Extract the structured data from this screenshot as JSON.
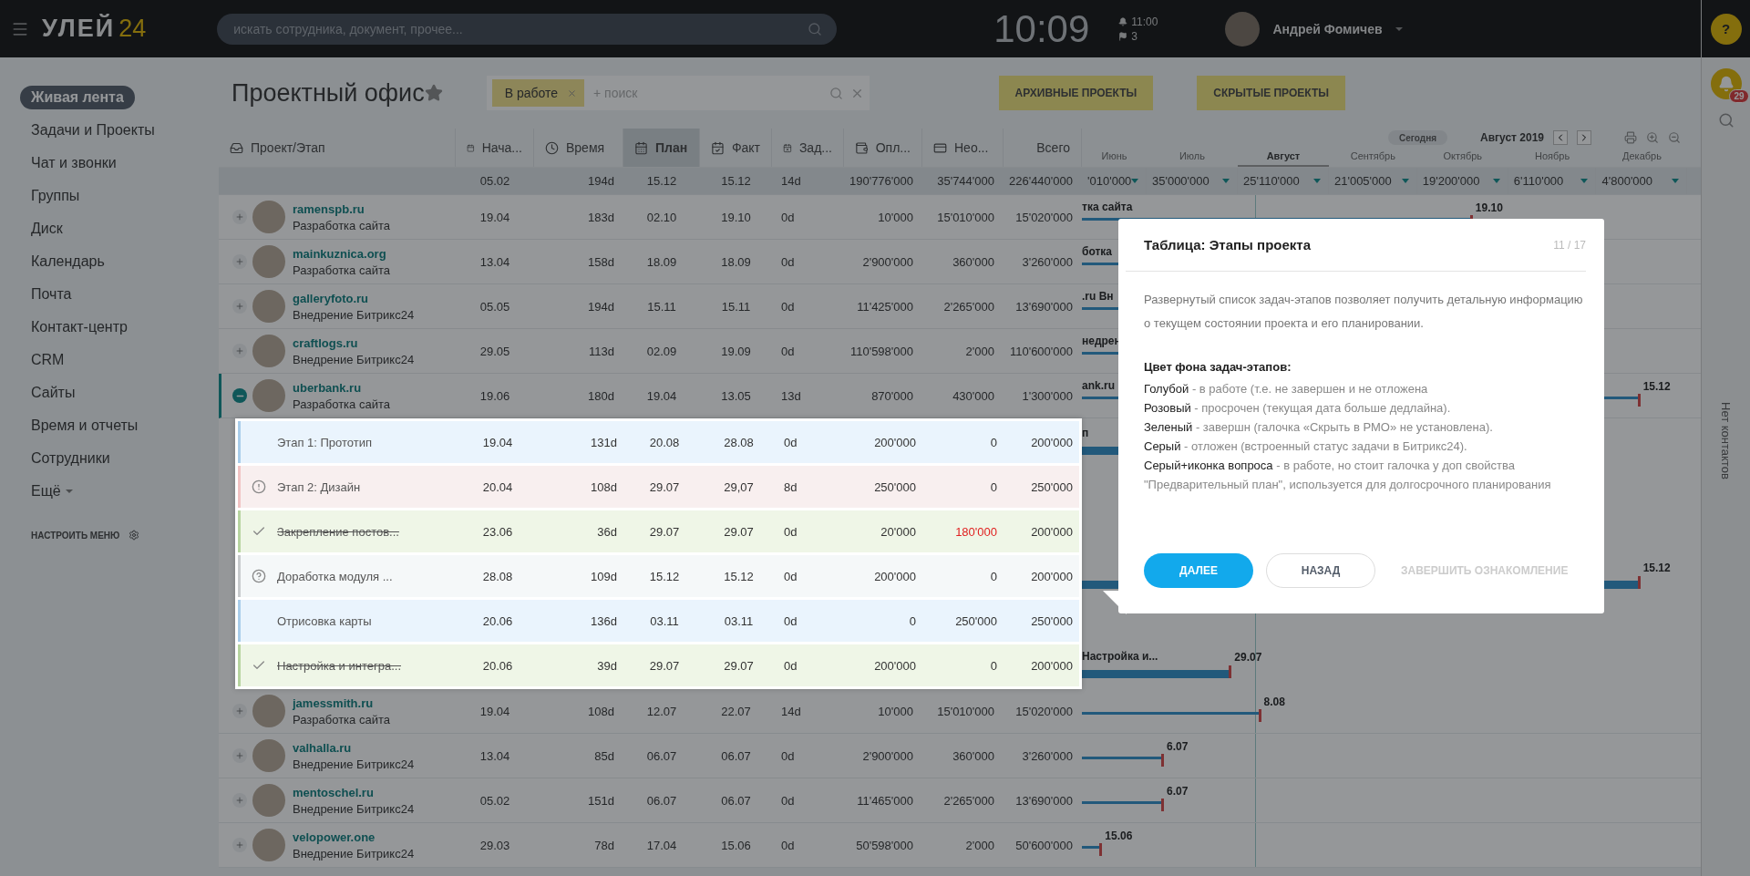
{
  "topbar": {
    "logo_word": "УЛЕЙ",
    "logo_number": "24",
    "search_placeholder": "искать сотрудника, документ, прочее...",
    "clock": "10:09",
    "alarm": "11:00",
    "flags": "3",
    "user_name": "Андрей Фомичев"
  },
  "sidebar": {
    "items": [
      {
        "label": "Живая лента",
        "selected": true
      },
      {
        "label": "Задачи и Проекты",
        "selected": false
      },
      {
        "label": "Чат и звонки",
        "selected": false
      },
      {
        "label": "Группы",
        "selected": false
      },
      {
        "label": "Диск",
        "selected": false
      },
      {
        "label": "Календарь",
        "selected": false
      },
      {
        "label": "Почта",
        "selected": false
      },
      {
        "label": "Контакт-центр",
        "selected": false
      },
      {
        "label": "CRM",
        "selected": false
      },
      {
        "label": "Сайты",
        "selected": false
      },
      {
        "label": "Время и отчеты",
        "selected": false
      },
      {
        "label": "Сотрудники",
        "selected": false
      },
      {
        "label": "Ещё",
        "selected": false
      }
    ],
    "configure": "НАСТРОИТЬ МЕНЮ"
  },
  "page": {
    "title": "Проектный офис",
    "filter_tag": "В работе",
    "filter_placeholder": "+ поиск",
    "buttons": [
      "АРХИВНЫЕ ПРОЕКТЫ",
      "СКРЫТЫЕ ПРОЕКТЫ"
    ]
  },
  "table": {
    "name_column": {
      "label": "Проект/Этап",
      "selected": false
    },
    "columns": [
      {
        "label": "Нача...",
        "selected": false
      },
      {
        "label": "Время",
        "selected": false
      },
      {
        "label": "План",
        "selected": true
      },
      {
        "label": "Факт",
        "selected": false
      },
      {
        "label": "Зад...",
        "selected": false
      },
      {
        "label": "Опл...",
        "selected": false
      },
      {
        "label": "Нео...",
        "selected": false
      },
      {
        "label": "Всего",
        "selected": false
      }
    ],
    "totals": [
      "05.02",
      "194d",
      "15.12",
      "15.12",
      "14d",
      "190'776'000",
      "35'744'000",
      "226'440'000"
    ],
    "rows": [
      {
        "name": "ramenspb.ru",
        "subtitle": "Разработка сайта",
        "cells": [
          "19.04",
          "183d",
          "02.10",
          "19.10",
          "0d",
          "10'000",
          "15'010'000",
          "15'020'000"
        ],
        "expanded": false,
        "gantt_title": "тка сайта",
        "gantt_label": "19.10"
      },
      {
        "name": "mainkuznica.org",
        "subtitle": "Разработка сайта",
        "cells": [
          "13.04",
          "158d",
          "18.09",
          "18.09",
          "0d",
          "2'900'000",
          "360'000",
          "3'260'000"
        ],
        "expanded": false,
        "gantt_title": "ботка"
      },
      {
        "name": "galleryfoto.ru",
        "subtitle": "Внедрение Битрикс24",
        "cells": [
          "05.05",
          "194d",
          "15.11",
          "15.11",
          "0d",
          "11'425'000",
          "2'265'000",
          "13'690'000"
        ],
        "expanded": false,
        "gantt_title": ".ru Вн"
      },
      {
        "name": "craftlogs.ru",
        "subtitle": "Внедрение Битрикс24",
        "cells": [
          "29.05",
          "113d",
          "02.09",
          "19.09",
          "0d",
          "110'598'000",
          "2'000",
          "110'600'000"
        ],
        "expanded": false,
        "gantt_title": "недрен"
      },
      {
        "name": "uberbank.ru",
        "subtitle": "Разработка сайта",
        "cells": [
          "19.06",
          "180d",
          "19.04",
          "13.05",
          "13d",
          "870'000",
          "430'000",
          "1'300'000"
        ],
        "expanded": true,
        "gantt_title": "ank.ru",
        "gantt_label": "15.12",
        "stages": [
          {
            "name": "Этап 1: Прототип",
            "kind": "in_progress",
            "cells": [
              "19.04",
              "131d",
              "20.08",
              "28.08",
              "0d",
              "200'000",
              "0",
              "200'000"
            ],
            "unpaid_alert": false,
            "gantt_title": "п"
          },
          {
            "name": "Этап 2: Дизайн",
            "kind": "overdue",
            "cells": [
              "20.04",
              "108d",
              "29.07",
              "29,07",
              "8d",
              "250'000",
              "0",
              "250'000"
            ],
            "unpaid_alert": false
          },
          {
            "name": "Закрепление постов...",
            "kind": "done",
            "cells": [
              "23.06",
              "36d",
              "29.07",
              "29.07",
              "0d",
              "20'000",
              "180'000",
              "200'000"
            ],
            "unpaid_alert": true
          },
          {
            "name": "Доработка модуля ...",
            "kind": "preliminary",
            "cells": [
              "28.08",
              "109d",
              "15.12",
              "15.12",
              "0d",
              "200'000",
              "0",
              "200'000"
            ],
            "unpaid_alert": false,
            "gantt_label": "15.12"
          },
          {
            "name": "Отрисовка карты",
            "kind": "in_progress",
            "cells": [
              "20.06",
              "136d",
              "03.11",
              "03.11",
              "0d",
              "0",
              "250'000",
              "250'000"
            ],
            "unpaid_alert": false
          },
          {
            "name": "Настройка и интегра...",
            "kind": "done",
            "cells": [
              "20.06",
              "39d",
              "29.07",
              "29.07",
              "0d",
              "200'000",
              "0",
              "200'000"
            ],
            "unpaid_alert": false,
            "gantt_title": "Настройка и...",
            "gantt_label": "29.07"
          }
        ]
      },
      {
        "name": "jamessmith.ru",
        "subtitle": "Разработка сайта",
        "cells": [
          "19.04",
          "108d",
          "12.07",
          "22.07",
          "14d",
          "10'000",
          "15'010'000",
          "15'020'000"
        ],
        "expanded": false,
        "gantt_label": "8.08"
      },
      {
        "name": "valhalla.ru",
        "subtitle": "Внедрение Битрикс24",
        "cells": [
          "13.04",
          "85d",
          "06.07",
          "06.07",
          "0d",
          "2'900'000",
          "360'000",
          "3'260'000"
        ],
        "expanded": false,
        "gantt_label": "6.07"
      },
      {
        "name": "mentoschel.ru",
        "subtitle": "Внедрение Битрикс24",
        "cells": [
          "05.02",
          "151d",
          "06.07",
          "06.07",
          "0d",
          "11'465'000",
          "2'265'000",
          "13'690'000"
        ],
        "expanded": false,
        "gantt_label": "6.07"
      },
      {
        "name": "velopower.one",
        "subtitle": "Внедрение Битрикс24",
        "cells": [
          "29.03",
          "78d",
          "17.04",
          "15.06",
          "0d",
          "50'598'000",
          "2'000",
          "50'600'000"
        ],
        "expanded": false,
        "gantt_label": "15.06"
      }
    ]
  },
  "gantt": {
    "today_button": "Сегодня",
    "period": "Август 2019",
    "months": [
      {
        "name": "Июнь",
        "total": "'010'000",
        "selected": false
      },
      {
        "name": "Июль",
        "total": "35'000'000",
        "selected": false
      },
      {
        "name": "Август",
        "total": "25'110'000",
        "selected": true
      },
      {
        "name": "Сентябрь",
        "total": "21'005'000",
        "selected": false
      },
      {
        "name": "Октябрь",
        "total": "19'200'000",
        "selected": false
      },
      {
        "name": "Ноябрь",
        "total": "6'110'000",
        "selected": false
      },
      {
        "name": "Декабрь",
        "total": "4'800'000",
        "selected": false
      }
    ]
  },
  "right_rail": {
    "help": "?",
    "notifications": "29",
    "contacts": "Нет контактов"
  },
  "tour": {
    "title": "Таблица: Этапы проекта",
    "counter": "11 / 17",
    "intro": "Развернутый список задач-этапов позволяет получить детальную информацию о текущем состоянии проекта и его планировании.",
    "legend_title": "Цвет фона задач-этапов:",
    "legend": [
      {
        "term": "Голубой",
        "text": " - в работе (т.е. не завершен и не отложена"
      },
      {
        "term": "Розовый",
        "text": " - просрочен (текущая дата больше дедлайна)."
      },
      {
        "term": "Зеленый",
        "text": " - завершн (галочка «Скрыть в РМО» не установлена)."
      },
      {
        "term": "Серый",
        "text": " - отложен (встроенный статус задачи в Битрикс24)."
      },
      {
        "term": "Серый+иконка вопроса",
        "text": " - в работе, но стоит галочка у доп свойства \"Предварительный план\", используется для долгосрочного планирования"
      }
    ],
    "next": "ДАЛЕЕ",
    "back": "НАЗАД",
    "finish": "ЗАВЕРШИТЬ ОЗНАКОМЛЕНИЕ"
  }
}
